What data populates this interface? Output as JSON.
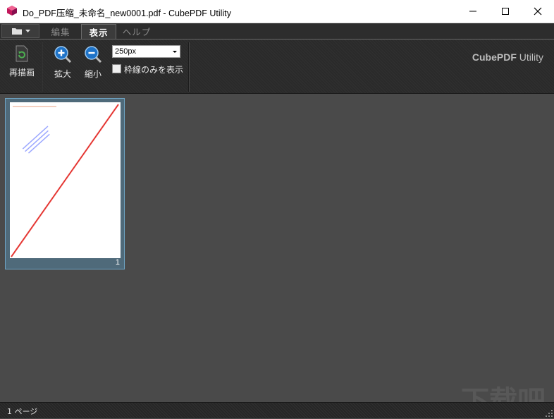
{
  "window": {
    "title": "Do_PDF压缩_未命名_new0001.pdf - CubePDF Utility"
  },
  "tabs": [
    {
      "label": "編集",
      "active": false
    },
    {
      "label": "表示",
      "active": true
    },
    {
      "label": "ヘルプ",
      "active": false
    }
  ],
  "ribbon": {
    "redraw_label": "再描画",
    "zoom_in_label": "拡大",
    "zoom_out_label": "縮小",
    "size_select_value": "250px",
    "frame_only_label": "枠線のみを表示",
    "frame_only_checked": false,
    "brand_bold": "CubePDF",
    "brand_light": "Utility"
  },
  "thumbnails": [
    {
      "page_number": "1",
      "selected": true
    }
  ],
  "status": {
    "text": "1 ページ"
  },
  "watermark": {
    "text": "下载吧"
  },
  "colors": {
    "accent_blue": "#2b7fd4",
    "selection_border": "#6ea4c4",
    "diagonal_line": "#e53935"
  }
}
